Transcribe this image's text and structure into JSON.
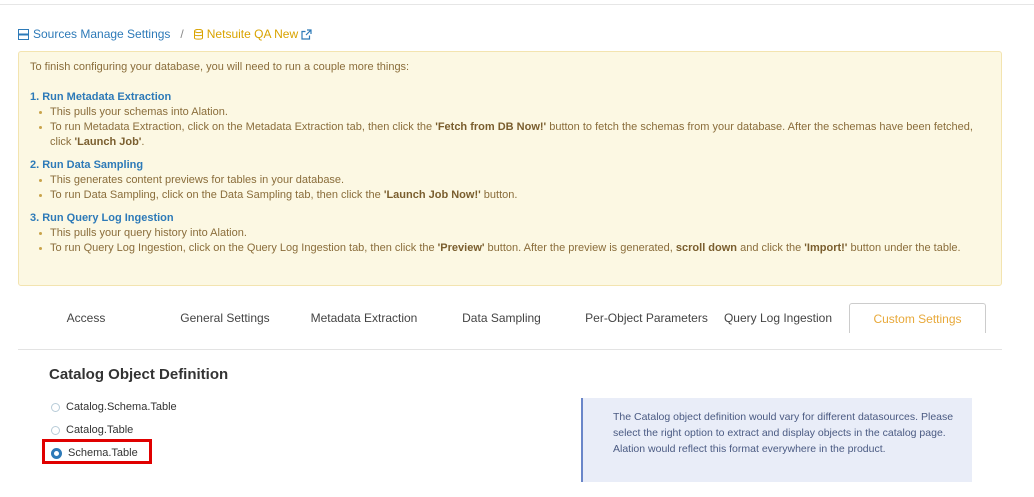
{
  "breadcrumb": {
    "parent_label": "Sources Manage Settings",
    "separator": "/",
    "current_label": "Netsuite QA New"
  },
  "notice": {
    "intro": "To finish configuring your database, you will need to run a couple more things:",
    "steps": [
      {
        "title": "1. Run Metadata Extraction",
        "line1": "This pulls your schemas into Alation.",
        "line2_a": "To run Metadata Extraction, click on the Metadata Extraction tab, then click the ",
        "line2_b": "'Fetch from DB Now!'",
        "line2_c": " button to fetch the schemas from your database. After the schemas have been fetched, click ",
        "line2_d": "'Launch Job'",
        "line2_e": "."
      },
      {
        "title": "2. Run Data Sampling",
        "line1": "This generates content previews for tables in your database.",
        "line2_a": "To run Data Sampling, click on the Data Sampling tab, then click the ",
        "line2_b": "'Launch Job Now!'",
        "line2_c": " button."
      },
      {
        "title": "3. Run Query Log Ingestion",
        "line1": "This pulls your query history into Alation.",
        "line2_a": "To run Query Log Ingestion, click on the Query Log Ingestion tab, then click the ",
        "line2_b": "'Preview'",
        "line2_c": " button. After the preview is generated, ",
        "line2_d": "scroll down",
        "line2_e": " and click the ",
        "line2_f": "'Import!'",
        "line2_g": " button under the table."
      }
    ]
  },
  "tabs": [
    "Access",
    "General Settings",
    "Metadata Extraction",
    "Data Sampling",
    "Per-Object Parameters",
    "Query Log Ingestion",
    "Custom Settings"
  ],
  "active_tab": "Custom Settings",
  "catalog": {
    "title": "Catalog Object Definition",
    "options": [
      "Catalog.Schema.Table",
      "Catalog.Table",
      "Schema.Table"
    ],
    "selected": "Schema.Table",
    "info": "The Catalog object definition would vary for different datasources. Please select the right option to extract and display objects in the catalog page. Alation would reflect this format everywhere in the product."
  },
  "colors": {
    "link_blue": "#2d7ab8",
    "active_tab": "#e8a93a",
    "highlight_red": "#e00000",
    "notice_bg": "#fcf8e3"
  }
}
